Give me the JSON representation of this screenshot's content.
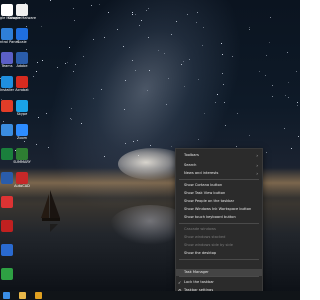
{
  "desktop_icons": [
    {
      "label": "Google Malware",
      "color": "#ffffff",
      "icon": "document-icon"
    },
    {
      "label": "Control Panel",
      "color": "#2f7fd8",
      "icon": "control-panel-icon"
    },
    {
      "label": "Teams",
      "color": "#5b5fc7",
      "icon": "teams-icon"
    },
    {
      "label": "Installer",
      "color": "#1f8fe0",
      "icon": "installer-icon"
    },
    {
      "label": "",
      "color": "#e23d28",
      "icon": "chrome-icon"
    },
    {
      "label": "",
      "color": "#3b8de0",
      "icon": "app-icon"
    },
    {
      "label": "",
      "color": "#1a7f3c",
      "icon": "spreadsheet-icon"
    },
    {
      "label": "",
      "color": "#2a5caa",
      "icon": "word-icon"
    },
    {
      "label": "",
      "color": "#d33",
      "icon": "app-icon"
    },
    {
      "label": "",
      "color": "#c02020",
      "icon": "pdf-icon"
    },
    {
      "label": "",
      "color": "#2a6ad0",
      "icon": "app-icon"
    },
    {
      "label": "",
      "color": "#2ea043",
      "icon": "app-icon"
    }
  ],
  "desktop_icons_col2": [
    {
      "label": "Google Malware",
      "color": "#f0f0f0"
    },
    {
      "label": "Scale",
      "color": "#1f6fe0"
    },
    {
      "label": "Adobe",
      "color": "#2a5caa"
    },
    {
      "label": "Acrobat",
      "color": "#d62b20"
    },
    {
      "label": "Skype",
      "color": "#1aa3e8"
    },
    {
      "label": "Zoom",
      "color": "#2d8cff"
    },
    {
      "label": "SUMMARY",
      "color": "#2e7d32"
    },
    {
      "label": "AutoCAD",
      "color": "#c62828"
    }
  ],
  "context_menu": {
    "items": [
      {
        "label": "Toolbars",
        "submenu": true,
        "disabled": false
      },
      {
        "label": "Search",
        "submenu": true,
        "disabled": false
      },
      {
        "label": "News and interests",
        "submenu": true,
        "disabled": false
      },
      {
        "label": "Show Cortana button",
        "disabled": false
      },
      {
        "label": "Show Task View button",
        "disabled": false
      },
      {
        "label": "Show People on the taskbar",
        "disabled": false
      },
      {
        "label": "Show Windows Ink Workspace button",
        "disabled": false
      },
      {
        "label": "Show touch keyboard button",
        "disabled": false
      },
      {
        "label": "Cascade windows",
        "disabled": true
      },
      {
        "label": "Show windows stacked",
        "disabled": true
      },
      {
        "label": "Show windows side by side",
        "disabled": true
      },
      {
        "label": "Show the desktop",
        "disabled": false
      },
      {
        "label": "Task Manager",
        "disabled": false,
        "highlighted": true
      },
      {
        "label": "Lock the taskbar",
        "disabled": false,
        "checked": true
      },
      {
        "label": "Taskbar settings",
        "disabled": false,
        "icon": "gear-icon"
      }
    ]
  },
  "taskbar": {
    "apps": [
      {
        "icon": "windows-start-icon",
        "color": "#3a8ee6"
      },
      {
        "icon": "file-explorer-icon",
        "color": "#e8b84a"
      },
      {
        "icon": "chrome-icon",
        "color": "#e0a020"
      }
    ]
  }
}
